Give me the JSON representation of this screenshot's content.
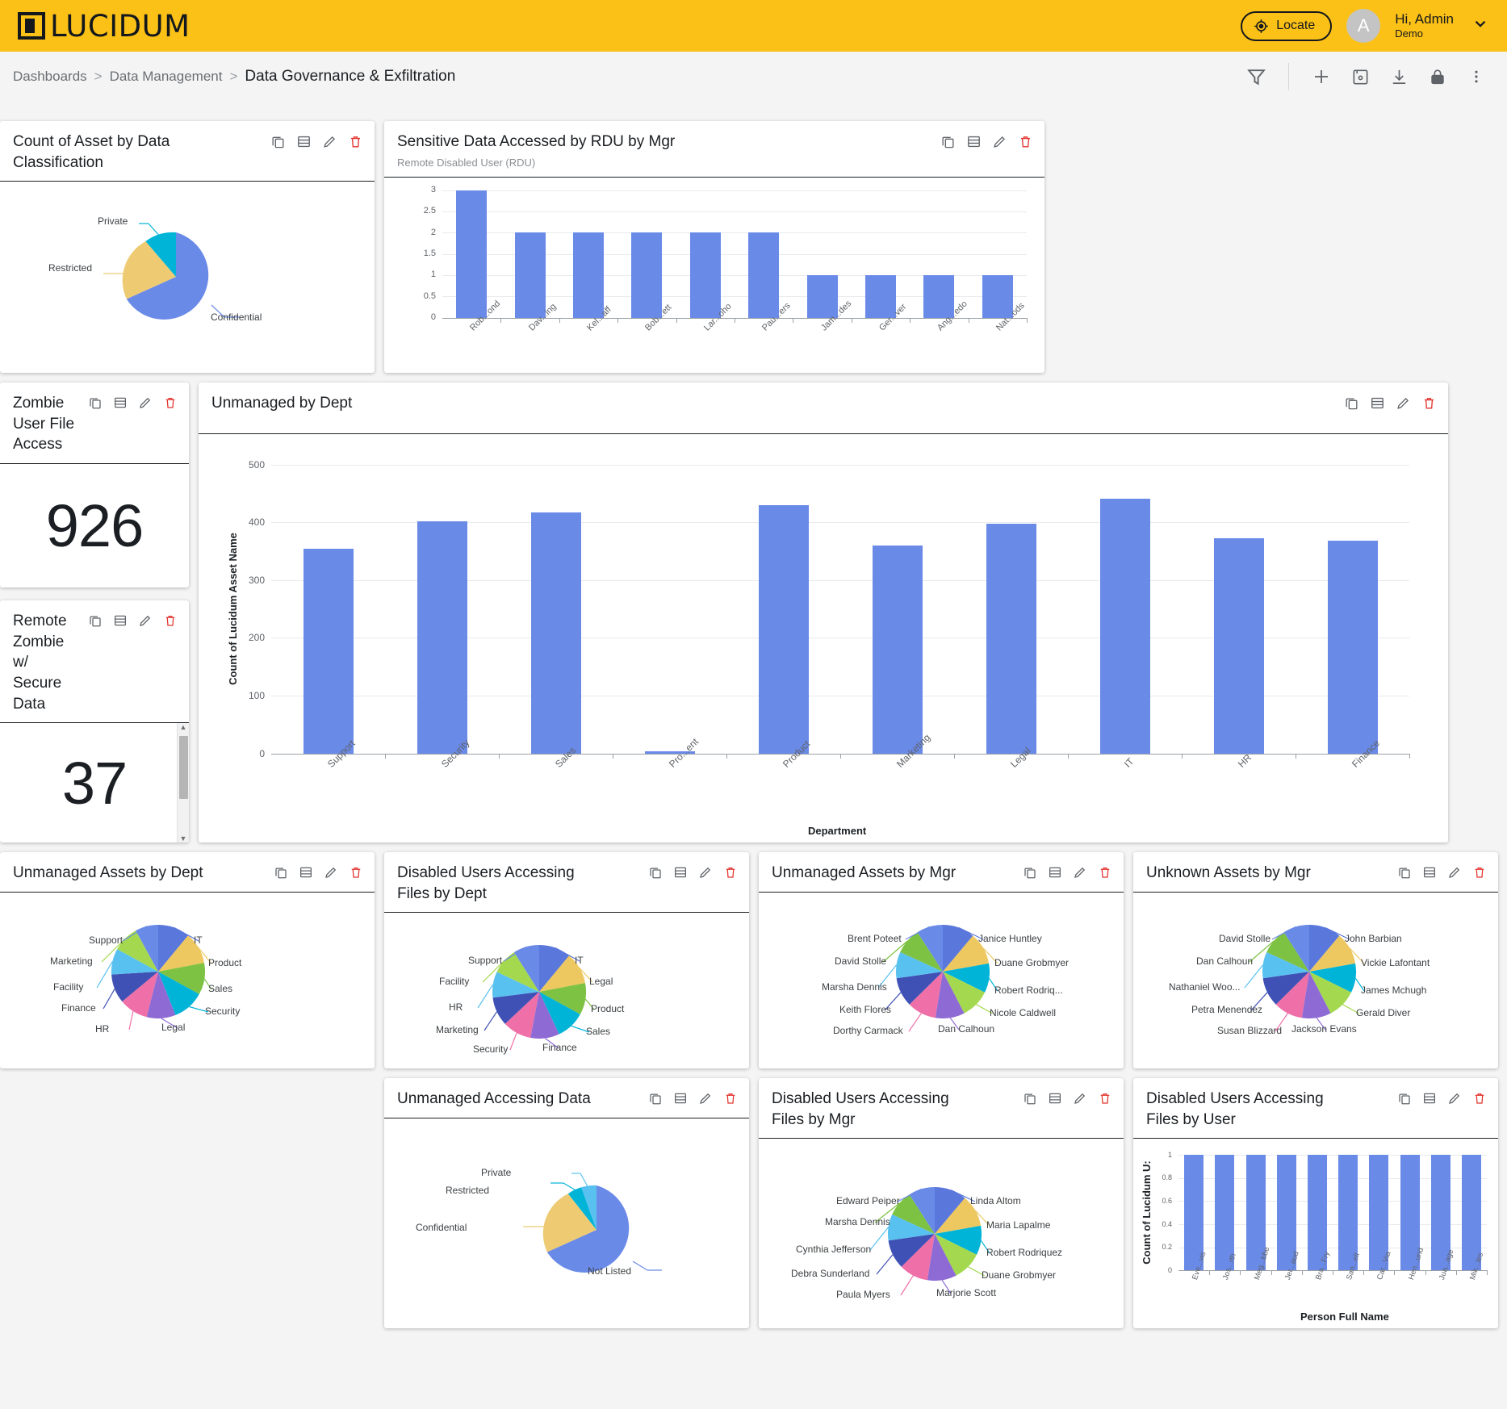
{
  "header": {
    "brand": "LUCIDUM",
    "brand_icon": "lucidum-logo-icon",
    "accent_color": "#fcc117",
    "locate_label": "Locate",
    "locate_icon": "crosshair-icon",
    "avatar_letter": "A",
    "user_greeting": "Hi, Admin",
    "user_tenant": "Demo",
    "chevron_icon": "chevron-down-icon"
  },
  "breadcrumb": {
    "items": [
      "Dashboards",
      "Data Management"
    ],
    "separator": ">",
    "current": "Data Governance & Exfiltration"
  },
  "toolbar": {
    "filter_icon": "filter-icon",
    "add_icon": "plus-icon",
    "save_icon": "save-icon",
    "download_icon": "download-icon",
    "lock_icon": "lock-icon",
    "more_icon": "more-vertical-icon"
  },
  "card_actions": {
    "copy": "copy-icon",
    "table": "table-icon",
    "edit": "pencil-icon",
    "delete": "trash-icon"
  },
  "cards": [
    {
      "id": "count-asset-by-classification",
      "title": "Count of Asset by Data Classification"
    },
    {
      "id": "sensitive-data-rdu-by-mgr",
      "title": "Sensitive Data Accessed by RDU by Mgr",
      "subtitle": "Remote Disabled User (RDU)"
    },
    {
      "id": "zombie-user-file-access",
      "title": "Zombie User File Access",
      "value": "926"
    },
    {
      "id": "remote-zombie-secure-data",
      "title": "Remote Zombie w/ Secure Data",
      "value": "37"
    },
    {
      "id": "unmanaged-by-dept",
      "title": "Unmanaged by Dept"
    },
    {
      "id": "unmanaged-assets-by-dept",
      "title": "Unmanaged Assets by Dept"
    },
    {
      "id": "disabled-users-files-by-dept",
      "title": "Disabled Users Accessing Files by Dept"
    },
    {
      "id": "unmanaged-assets-by-mgr",
      "title": "Unmanaged Assets by Mgr"
    },
    {
      "id": "unknown-assets-by-mgr",
      "title": "Unknown Assets by Mgr"
    },
    {
      "id": "unmanaged-accessing-data",
      "title": "Unmanaged Accessing Data"
    },
    {
      "id": "disabled-users-files-by-mgr",
      "title": "Disabled Users Accessing Files by Mgr"
    },
    {
      "id": "disabled-users-files-by-user",
      "title": "Disabled Users Accessing Files by User"
    }
  ],
  "chart_data": [
    {
      "id": "count-asset-by-classification",
      "type": "pie",
      "title": "Count of Asset by Data Classification",
      "labels": [
        "Confidential",
        "Restricted",
        "Private"
      ],
      "values": [
        72,
        18,
        10
      ],
      "colors": [
        "#6a8ae8",
        "#eecb73",
        "#00b4d8"
      ],
      "legend": "labels-outside"
    },
    {
      "id": "sensitive-data-rdu-by-mgr",
      "type": "bar",
      "title": "Sensitive Data Accessed by RDU by Mgr",
      "subtitle": "Remote Disabled User (RDU)",
      "categories": [
        "Rob...ond",
        "Dav...ing",
        "Kel...aff",
        "Bob...ett",
        "Lar...oho",
        "Pau...ers",
        "Jam...des",
        "Ger...ver",
        "Ang...edo",
        "Nat...ods"
      ],
      "values": [
        3,
        2,
        2,
        2,
        2,
        2,
        1,
        1,
        1,
        1
      ],
      "ylim": [
        0,
        3
      ],
      "yticks": [
        "0",
        "0.5",
        "1",
        "1.5",
        "2",
        "2.5",
        "3"
      ],
      "xlabel": "",
      "ylabel": "",
      "grid": true,
      "color": "#6a8ae8"
    },
    {
      "id": "unmanaged-by-dept",
      "type": "bar",
      "title": "Unmanaged by Dept",
      "categories": [
        "Support",
        "Security",
        "Sales",
        "Pro...ent",
        "Product",
        "Marketing",
        "Legal",
        "IT",
        "HR",
        "Finance"
      ],
      "values": [
        354,
        402,
        417,
        3,
        430,
        360,
        397,
        441,
        372,
        368
      ],
      "ylim": [
        0,
        500
      ],
      "yticks": [
        "0",
        "100",
        "200",
        "300",
        "400",
        "500"
      ],
      "xlabel": "Department",
      "ylabel": "Count of Lucidum Asset Name",
      "grid": true,
      "color": "#6a8ae8"
    },
    {
      "id": "unmanaged-assets-by-dept",
      "type": "pie",
      "title": "Unmanaged Assets by Dept",
      "labels": [
        "IT",
        "Product",
        "Sales",
        "Security",
        "Legal",
        "HR",
        "Finance",
        "Facility",
        "Marketing",
        "Support"
      ],
      "values": [
        11,
        11,
        11,
        11,
        10,
        10,
        10,
        9,
        9,
        8
      ],
      "colors": [
        "#5a77db",
        "#edc75f",
        "#7dc242",
        "#00b4d8",
        "#8e6bd4",
        "#ef6fa8",
        "#3f51b5",
        "#59c1ef",
        "#a4d94f",
        "#6a8ae8"
      ]
    },
    {
      "id": "disabled-users-files-by-dept",
      "type": "pie",
      "title": "Disabled Users Accessing Files by Dept",
      "labels": [
        "IT",
        "Legal",
        "Product",
        "Sales",
        "Finance",
        "Security",
        "Marketing",
        "HR",
        "Facility",
        "Support"
      ],
      "values": [
        11,
        11,
        11,
        10,
        10,
        10,
        10,
        9,
        9,
        9
      ],
      "colors": [
        "#5a77db",
        "#edc75f",
        "#7dc242",
        "#00b4d8",
        "#8e6bd4",
        "#ef6fa8",
        "#3f51b5",
        "#59c1ef",
        "#a4d94f",
        "#6a8ae8"
      ]
    },
    {
      "id": "unmanaged-assets-by-mgr",
      "type": "pie",
      "title": "Unmanaged Assets by Mgr",
      "labels": [
        "Janice Huntley",
        "Duane Grobmyer",
        "Robert Rodriq...",
        "Nicole Caldwell",
        "Dan Calhoun",
        "Dorthy Carmack",
        "Keith Flores",
        "Marsha Dennis",
        "David Stolle",
        "Brent Poteet"
      ],
      "values": [
        11,
        11,
        10,
        10,
        10,
        10,
        10,
        9,
        9,
        9
      ],
      "colors": [
        "#5a77db",
        "#edc75f",
        "#00b4d8",
        "#a4d94f",
        "#8e6bd4",
        "#ef6fa8",
        "#3f51b5",
        "#59c1ef",
        "#7dc242",
        "#6a8ae8"
      ]
    },
    {
      "id": "unknown-assets-by-mgr",
      "type": "pie",
      "title": "Unknown Assets by Mgr",
      "labels": [
        "John Barbian",
        "Vickie Lafontant",
        "James Mchugh",
        "Gerald Diver",
        "Jackson Evans",
        "Susan Blizzard",
        "Petra Menendez",
        "Nathaniel Woo...",
        "Dan Calhoun",
        "David Stolle"
      ],
      "values": [
        11,
        11,
        10,
        10,
        10,
        10,
        10,
        9,
        9,
        9
      ],
      "colors": [
        "#5a77db",
        "#edc75f",
        "#00b4d8",
        "#a4d94f",
        "#8e6bd4",
        "#ef6fa8",
        "#3f51b5",
        "#59c1ef",
        "#7dc242",
        "#6a8ae8"
      ]
    },
    {
      "id": "unmanaged-accessing-data",
      "type": "pie",
      "title": "Unmanaged Accessing Data",
      "labels": [
        "Not Listed",
        "Confidential",
        "Restricted",
        "Private"
      ],
      "values": [
        72,
        18,
        6,
        4
      ],
      "colors": [
        "#6a8ae8",
        "#eecb73",
        "#00b4d8",
        "#59c1ef"
      ]
    },
    {
      "id": "disabled-users-files-by-mgr",
      "type": "pie",
      "title": "Disabled Users Accessing Files by Mgr",
      "labels": [
        "Linda Altom",
        "Maria Lapalme",
        "Robert Rodriquez",
        "Duane Grobmyer",
        "Marjorie Scott",
        "Paula Myers",
        "Debra Sunderland",
        "Cynthia Jefferson",
        "Marsha Dennis",
        "Edward Peiper"
      ],
      "values": [
        11,
        11,
        10,
        10,
        10,
        10,
        10,
        9,
        9,
        9
      ],
      "colors": [
        "#5a77db",
        "#edc75f",
        "#00b4d8",
        "#a4d94f",
        "#8e6bd4",
        "#ef6fa8",
        "#3f51b5",
        "#59c1ef",
        "#7dc242",
        "#6a8ae8"
      ]
    },
    {
      "id": "disabled-users-files-by-user",
      "type": "bar",
      "title": "Disabled Users Accessing Files by User",
      "categories": [
        "Eve...vis",
        "Jos...rth",
        "Meg...bbe",
        "Jer...aud",
        "Bra...Fry",
        "San...ell",
        "Car...Via",
        "Hen...und",
        "Jua...age",
        "Mik...les"
      ],
      "values": [
        1,
        1,
        1,
        1,
        1,
        1,
        1,
        1,
        1,
        1
      ],
      "ylim": [
        0,
        1
      ],
      "yticks": [
        "0",
        "0.2",
        "0.4",
        "0.6",
        "0.8",
        "1"
      ],
      "xlabel": "Person Full Name",
      "ylabel": "Count of Lucidum U:",
      "grid": true,
      "color": "#6a8ae8"
    }
  ]
}
